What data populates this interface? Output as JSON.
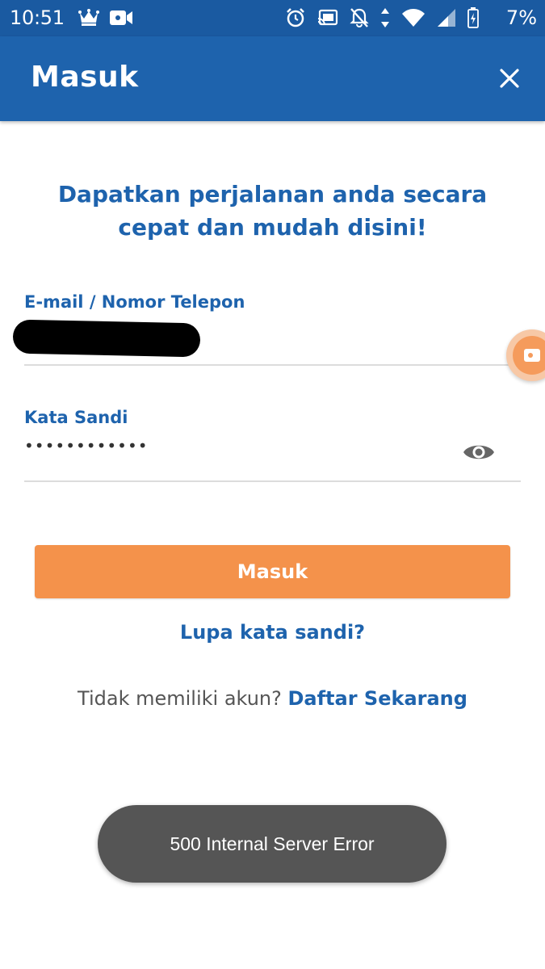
{
  "status_bar": {
    "time": "10:51",
    "battery": "7%",
    "left_icons": [
      "crown-icon",
      "video-camera-icon"
    ],
    "right_icons": [
      "alarm-icon",
      "cast-icon",
      "notifications-off-icon",
      "data-arrows-icon",
      "wifi-icon",
      "cell-signal-icon",
      "battery-charging-icon"
    ]
  },
  "appbar": {
    "title": "Masuk",
    "close_icon": "close-icon"
  },
  "headline": "Dapatkan perjalanan anda secara cepat dan mudah disini!",
  "email_field": {
    "label": "E-mail / Nomor Telepon",
    "value": ""
  },
  "password_field": {
    "label": "Kata Sandi",
    "value": "••••••••••••",
    "toggle_icon": "eye-icon"
  },
  "login_button": "Masuk",
  "forgot_password": "Lupa kata sandi?",
  "register": {
    "prompt": "Tidak memiliki akun?",
    "link": "Daftar Sekarang"
  },
  "toast": "500 Internal Server Error",
  "colors": {
    "primary": "#1e63ad",
    "status_bar": "#1a5aa1",
    "accent": "#f4924b",
    "toast": "#555555"
  }
}
